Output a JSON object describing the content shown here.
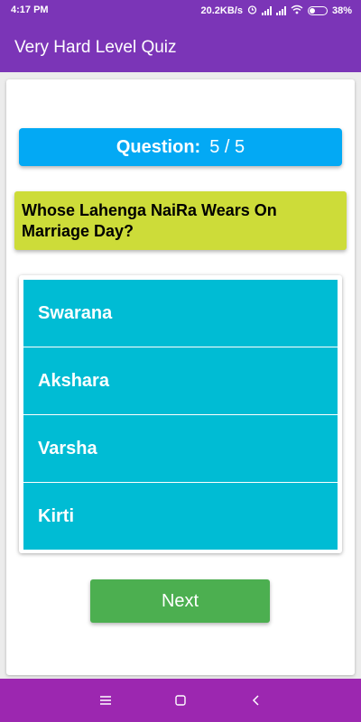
{
  "status_bar": {
    "time": "4:17 PM",
    "network_speed": "20.2KB/s",
    "battery": "38%",
    "battery_level": 0.38,
    "icons": [
      "alarm-icon",
      "signal-icon",
      "signal-icon",
      "wifi-icon",
      "battery-icon"
    ]
  },
  "app_bar": {
    "title": "Very Hard Level Quiz"
  },
  "quiz": {
    "counter_label": "Question:",
    "counter_value": "5 / 5",
    "question": "Whose Lahenga NaiRa Wears On Marriage Day?",
    "options": [
      "Swarana",
      "Akshara",
      "Varsha",
      "Kirti"
    ],
    "next_label": "Next"
  },
  "nav_bar": {
    "icons": [
      "menu-icon",
      "home-square-icon",
      "back-chevron-icon"
    ]
  },
  "colors": {
    "app_bar": "#7b35b7",
    "nav_bar": "#9c27b0",
    "counter_bg": "#03a9f4",
    "question_bg": "#cddc39",
    "option_bg": "#00bcd4",
    "next_bg": "#4caf50"
  }
}
